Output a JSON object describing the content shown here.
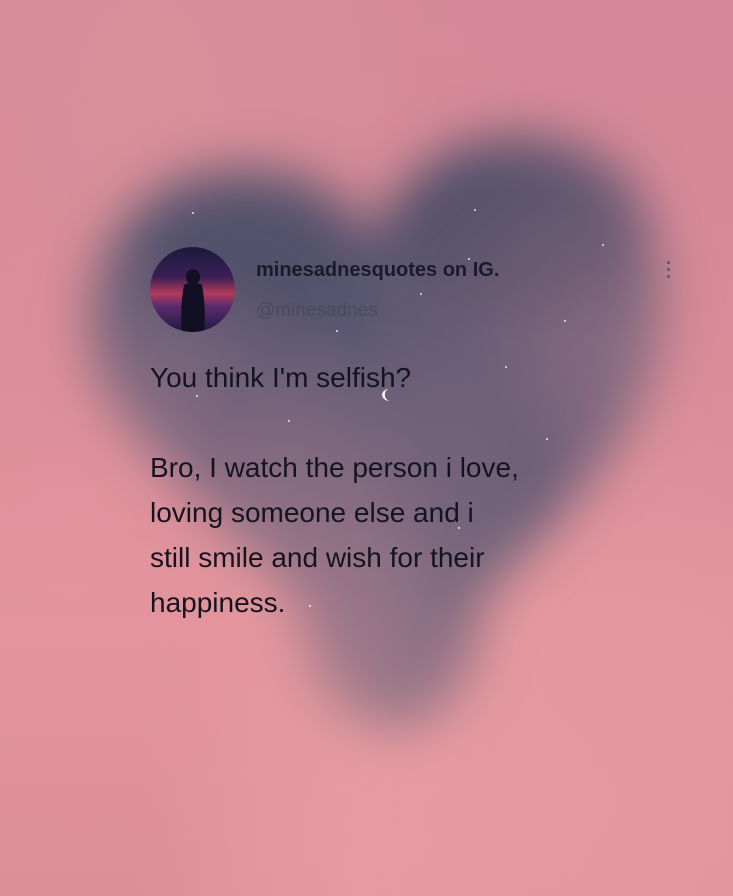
{
  "post": {
    "display_name": "minesadnesquotes on IG.",
    "handle": "@minesadnes",
    "line1": "You think I'm selfish?",
    "line2a": "Bro, I watch the person i love,",
    "line2b": "loving someone else and i",
    "line2c": "still smile and wish for their",
    "line2d": "happiness."
  },
  "icons": {
    "avatar": "profile-avatar",
    "more": "more-options-icon",
    "moon": "crescent-moon"
  },
  "colors": {
    "sky_pink": "#d88a95",
    "heart_cloud": "#5a5870",
    "text": "#14141f"
  }
}
